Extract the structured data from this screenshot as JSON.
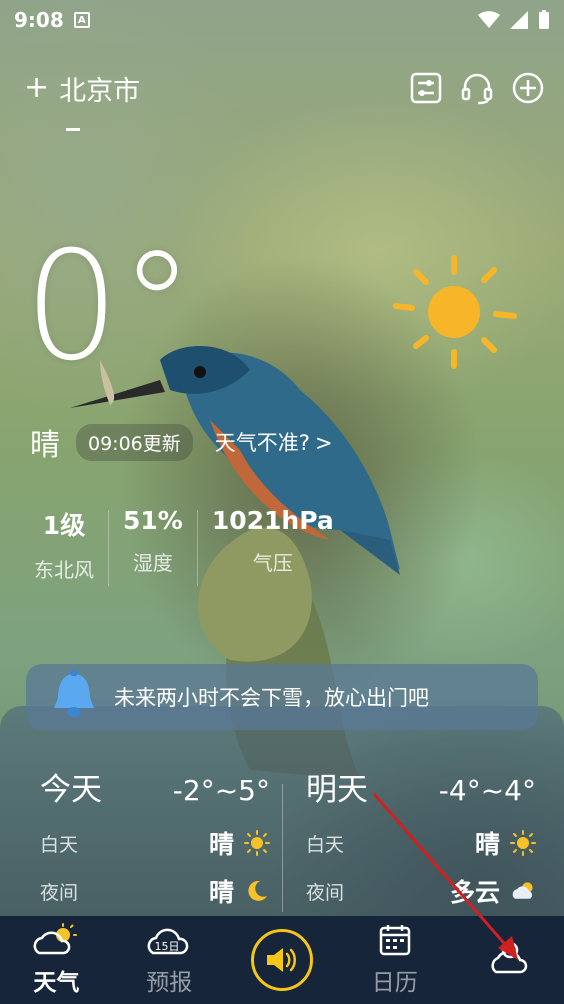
{
  "status_bar": {
    "time": "9:08",
    "app_badge": "A"
  },
  "header": {
    "add_symbol": "+",
    "city": "北京市"
  },
  "current": {
    "temperature": "0°",
    "condition": "晴",
    "updated": "09:06更新",
    "inaccurate_link": "天气不准?",
    "chevron": ">"
  },
  "stats": [
    {
      "value": "1级",
      "label": "东北风"
    },
    {
      "value": "51%",
      "label": "湿度"
    },
    {
      "value": "1021hPa",
      "label": "气压"
    }
  ],
  "alert": {
    "message": "未来两小时不会下雪，放心出门吧"
  },
  "forecast": {
    "today": {
      "day": "今天",
      "range": "-2°~5°",
      "daytime_label": "白天",
      "daytime_cond": "晴",
      "night_label": "夜间",
      "night_cond": "晴"
    },
    "tomorrow": {
      "day": "明天",
      "range": "-4°~4°",
      "daytime_label": "白天",
      "daytime_cond": "晴",
      "night_label": "夜间",
      "night_cond": "多云"
    }
  },
  "tabs": [
    {
      "label": "天气",
      "icon": "cloud-sun-icon",
      "active": true
    },
    {
      "label": "预报",
      "icon": "forecast-15day-icon",
      "badge": "15日",
      "active": false
    },
    {
      "label": "",
      "icon": "speaker-icon",
      "active": false
    },
    {
      "label": "日历",
      "icon": "calendar-icon",
      "active": false
    },
    {
      "label": "",
      "icon": "cloud-person-icon",
      "active": false
    }
  ],
  "colors": {
    "accent": "#f5c518",
    "tabbar": "#16253a",
    "sun": "#f7b52a",
    "arrow": "#d02020"
  }
}
